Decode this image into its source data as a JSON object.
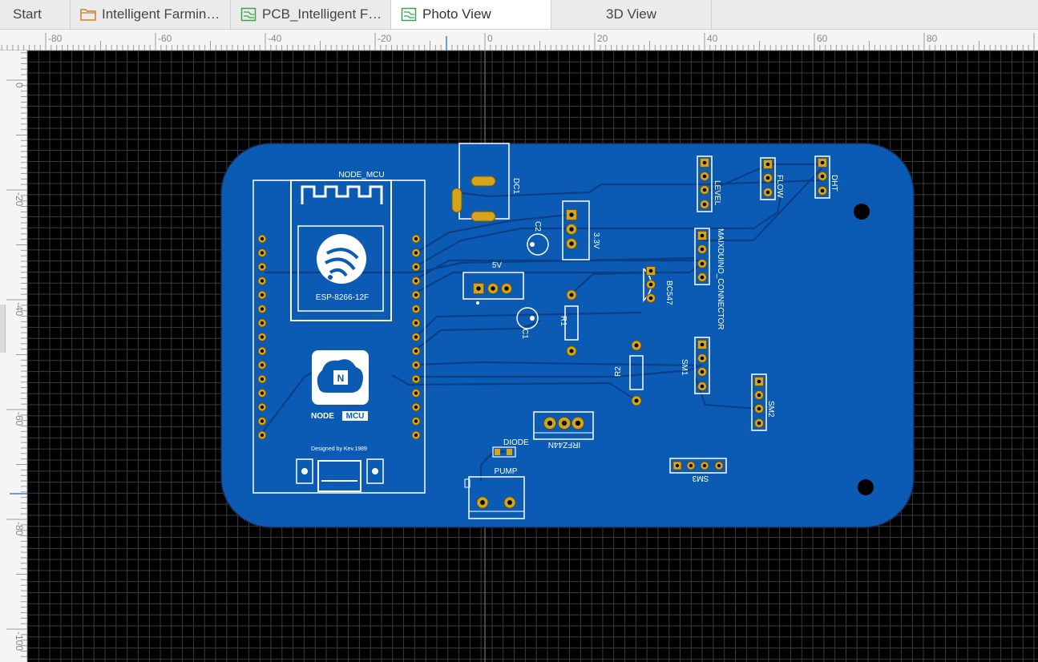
{
  "tabs": [
    {
      "label": "Start",
      "icon": "none",
      "active": false
    },
    {
      "label": "Intelligent Farmin…",
      "icon": "folder-icon",
      "active": false
    },
    {
      "label": "PCB_Intelligent F…",
      "icon": "pcb-icon",
      "active": false
    },
    {
      "label": "Photo View",
      "icon": "pcb-icon",
      "active": true
    },
    {
      "label": "3D View",
      "icon": "none",
      "active": false
    }
  ],
  "ruler": {
    "top_ticks": [
      "-80",
      "-60",
      "-40",
      "-20",
      "0",
      "20",
      "40",
      "60",
      "80"
    ],
    "left_ticks": [
      "0",
      "-20",
      "-40",
      "-60",
      "-80",
      "-100"
    ]
  },
  "board": {
    "color": "#0b5bb5",
    "module": {
      "title": "NODE_MCU",
      "chip_label": "ESP-8266-12F",
      "logo_text_a": "NODE",
      "logo_text_b": "MCU",
      "designer": "Designed by Kev.1989"
    },
    "labels": {
      "dc1": "DC1",
      "c2": "C2",
      "v33": "3.3V",
      "v5": "5V",
      "c1": "C1",
      "r1": "R1",
      "r2": "R2",
      "bc547": "BC547",
      "level": "LEVEL",
      "flow": "FLOW",
      "dht": "DHT",
      "maixduino": "MAIXDUINO_CONNECTOR",
      "sm1": "SM1",
      "sm2": "SM2",
      "sm3": "SM3",
      "irfz44n": "IRFZ44N",
      "diode": "DIODE",
      "pump": "PUMP"
    }
  }
}
